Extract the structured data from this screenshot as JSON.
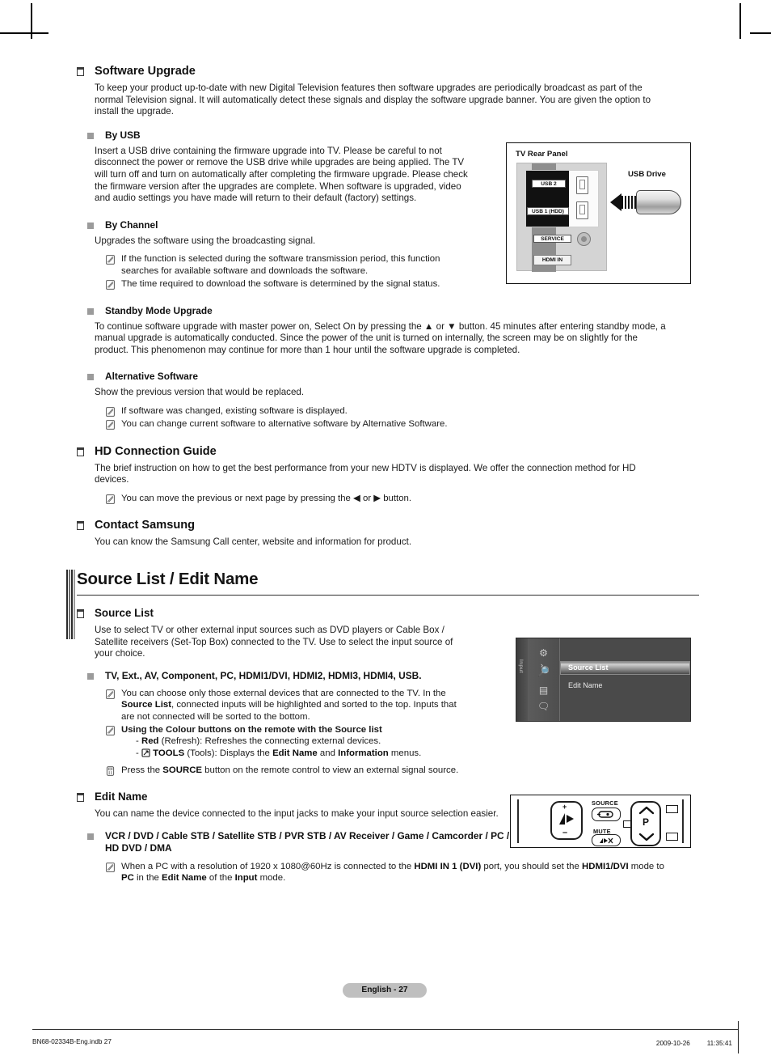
{
  "page": {
    "footer_pill": "English - 27",
    "footer_left": "BN68-02334B-Eng.indb   27",
    "footer_right": "2009-10-26   　　 11:35:41"
  },
  "software_upgrade": {
    "title": "Software Upgrade",
    "intro": "To keep your product up-to-date with new Digital Television features then software upgrades are periodically broadcast as part of the normal Television signal. It will automatically detect these signals and display the software upgrade banner. You are given the option to install the upgrade.",
    "by_usb": {
      "title": "By USB",
      "text": "Insert a USB drive containing the firmware upgrade into TV. Please be careful to not disconnect the power or remove the USB drive while upgrades are being applied. The TV will turn off and turn on automatically after completing the firmware upgrade. Please check the firmware version after the upgrades are complete. When software is upgraded, video and audio settings you have made will return to their default (factory) settings."
    },
    "by_channel": {
      "title": "By Channel",
      "text": "Upgrades the software using the broadcasting signal.",
      "notes": [
        "If the function is selected during the software transmission period, this function searches for available software and downloads the software.",
        "The time required to download the software is determined by the signal status."
      ]
    },
    "standby": {
      "title": "Standby Mode Upgrade",
      "text": "To continue software upgrade with master power on, Select On by pressing the ▲ or ▼ button. 45 minutes after entering standby mode, a manual upgrade is automatically conducted. Since the power of the unit is turned on internally, the screen may be on slightly for the product. This phenomenon may continue for more than 1 hour until the software upgrade is completed."
    },
    "alternative": {
      "title": "Alternative Software",
      "text": "Show the previous version that would be replaced.",
      "notes": [
        "If software was changed, existing software is displayed.",
        "You can change current software to alternative software by Alternative Software."
      ]
    }
  },
  "hd_connection_guide": {
    "title": "HD Connection Guide",
    "text": "The brief instruction on how to get the best performance from your new HDTV is displayed. We offer the connection method for HD devices.",
    "note": "You can move the previous or next page by pressing the ◀ or ▶ button."
  },
  "contact_samsung": {
    "title": "Contact Samsung",
    "text": "You can know the Samsung Call center, website and information for product."
  },
  "section": {
    "title": "Source List / Edit Name"
  },
  "source_list": {
    "title": "Source List",
    "text": "Use to select TV or other external input sources such as DVD players or Cable Box / Satellite receivers (Set-Top Box) connected to the TV. Use to select the input source of your choice.",
    "inputs_heading": "TV, Ext., AV, Component, PC, HDMI1/DVI, HDMI2, HDMI3, HDMI4, USB.",
    "note_connected_prefix": "You can choose only those external devices that are connected to the TV. In the ",
    "note_connected_bold": "Source List",
    "note_connected_suffix": ", connected inputs will be highlighted and sorted to the top. Inputs that are not connected will be sorted to the bottom.",
    "colour_heading": "Using the Colour buttons on the remote with the Source list",
    "red_label": "Red",
    "red_text": " (Refresh): Refreshes the connecting external devices.",
    "tools_label": "TOOLS",
    "tools_text_a": " (Tools): Displays the ",
    "tools_bold_a": "Edit Name",
    "tools_text_b": " and ",
    "tools_bold_b": "Information",
    "tools_text_c": " menus.",
    "source_note_a": "Press the ",
    "source_note_bold": "SOURCE",
    "source_note_b": " button on the remote control to view an external signal source."
  },
  "edit_name": {
    "title": "Edit Name",
    "text": "You can name the device connected to the input jacks to make your input source selection easier.",
    "device_list": "VCR / DVD / Cable STB / Satellite STB / PVR STB / AV Receiver / Game / Camcorder / PC / DVI / DVI PC / TV / IPTV / Blu-ray / HD DVD / DMA",
    "note_a": "When a PC with a resolution of 1920 x 1080@60Hz is connected to the ",
    "note_bold_a": "HDMI IN 1 (DVI)",
    "note_b": "  port, you should set the ",
    "note_bold_b": "HDMI1/DVI",
    "note_c": " mode to ",
    "note_bold_c": "PC",
    "note_d": " in the ",
    "note_bold_d": "Edit Name",
    "note_e": " of the ",
    "note_bold_e": "Input",
    "note_f": " mode."
  },
  "figure_rear_panel": {
    "caption": "TV Rear Panel",
    "usb_drive_label": "USB Drive",
    "ports": {
      "usb2": "USB 2",
      "usb1": "USB 1 (HDD)",
      "service": "SERVICE",
      "hdmi_in": "HDMI IN"
    }
  },
  "figure_osd": {
    "rail_label": "Input",
    "items": [
      {
        "label": "Source List",
        "selected": true
      },
      {
        "label": "Edit Name",
        "selected": false
      }
    ],
    "icons": [
      "gear-icon",
      "input-source-icon",
      "edit-name-icon",
      "help-icon"
    ]
  },
  "figure_remote": {
    "source_label": "SOURCE",
    "mute_label": "MUTE",
    "channel_label": "P",
    "volume_plus": "+",
    "volume_minus": "–"
  }
}
